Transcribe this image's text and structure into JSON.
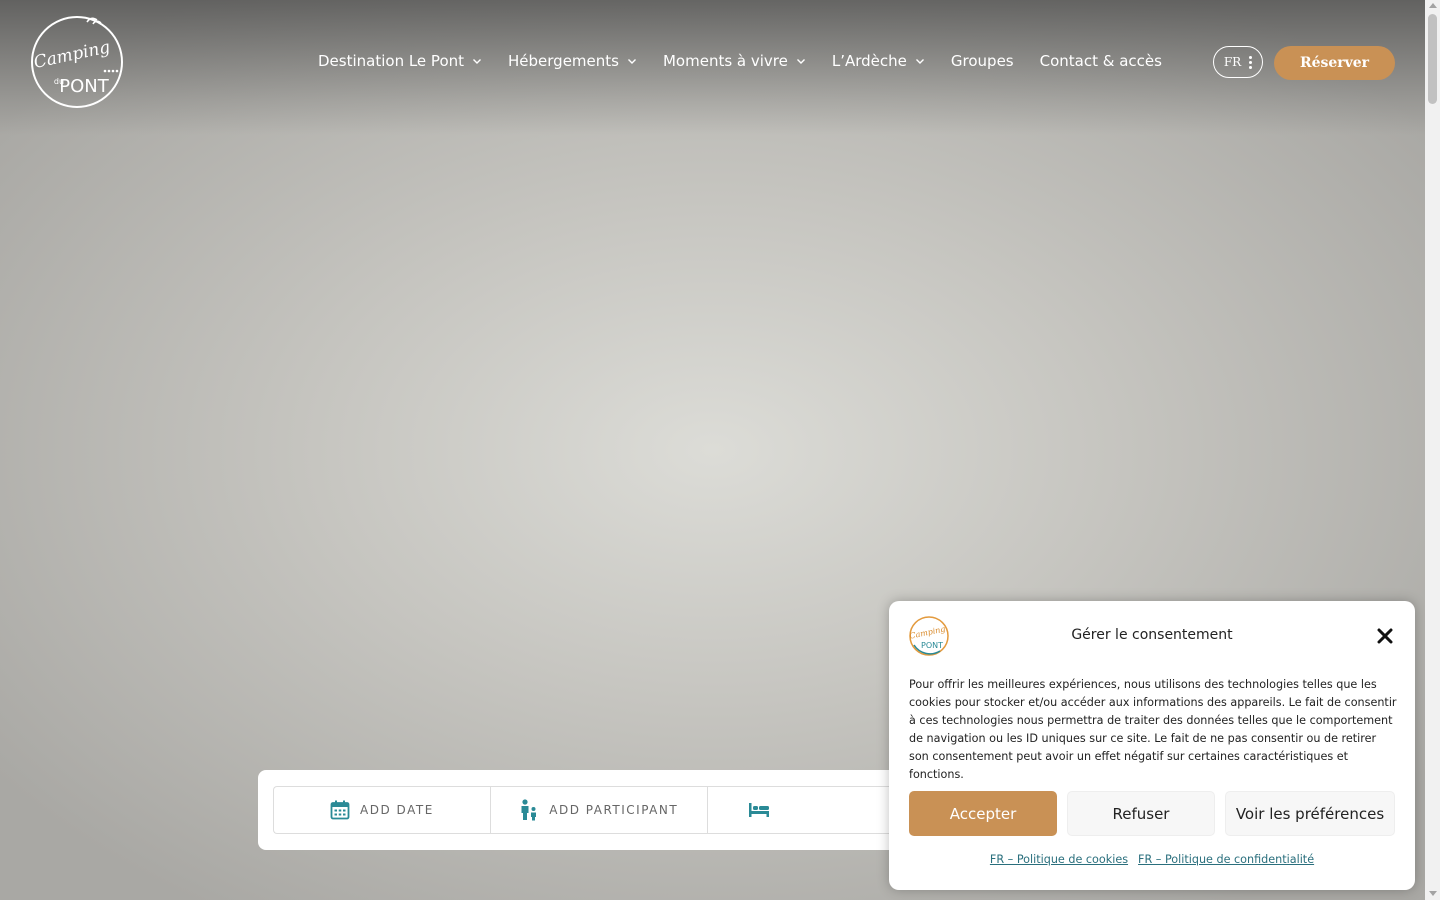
{
  "header": {
    "logo": {
      "line1": "Camping",
      "line2": "du",
      "line3": "PONT",
      "icon": "camping-logo"
    },
    "nav": [
      {
        "label": "Destination Le Pont",
        "has_dropdown": true
      },
      {
        "label": "Hébergements",
        "has_dropdown": true
      },
      {
        "label": "Moments à vivre",
        "has_dropdown": true
      },
      {
        "label": "L’Ardèche",
        "has_dropdown": true
      },
      {
        "label": "Groupes",
        "has_dropdown": false
      },
      {
        "label": "Contact & accès",
        "has_dropdown": false
      }
    ],
    "language": "FR",
    "reserve_label": "Réserver"
  },
  "booking": {
    "date_label": "ADD DATE",
    "participant_label": "ADD PARTICIPANT",
    "accommodation_icon": "bed-icon"
  },
  "consent": {
    "title": "Gérer le consentement",
    "text": "Pour offrir les meilleures expériences, nous utilisons des technologies telles que les cookies pour stocker et/ou accéder aux informations des appareils. Le fait de consentir à ces technologies nous permettra de traiter des données telles que le comportement de navigation ou les ID uniques sur ce site. Le fait de ne pas consentir ou de retirer son consentement peut avoir un effet négatif sur certaines caractéristiques et fonctions.",
    "accept_label": "Accepter",
    "refuse_label": "Refuser",
    "preferences_label": "Voir les préférences",
    "cookie_policy_link": "FR – Politique de cookies",
    "privacy_policy_link": "FR – Politique de confidentialité"
  },
  "colors": {
    "accent": "#c99155",
    "link": "#2a6f7d",
    "icon_teal": "#2a8a96"
  }
}
